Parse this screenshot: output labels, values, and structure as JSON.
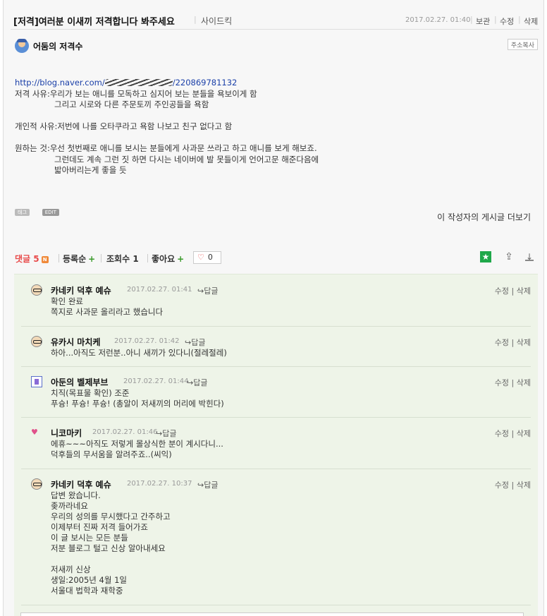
{
  "post": {
    "title": "[저격]여러분 이새끼 저격합니다 봐주세요",
    "category": "사이드킥",
    "date": "2017.02.27. 01:40",
    "actions": {
      "save": "보관",
      "edit": "수정",
      "delete": "삭제"
    },
    "author": "어둠의 저격수",
    "copy_address": "주소복사",
    "url_start": "http://blog.naver.com/",
    "url_end": "/220869781132",
    "lines": [
      "저격 사유:우리가 보는 애니를 모독하고 심지어 보는 분들을 욕보이게 함",
      "그리고 시로와 다른 주문토끼 주인공들을 욕함",
      "개인적 사유:저번에 나를 오타쿠라고 욕함 나보고 친구 없다고 함",
      "원하는 것:우선 첫번째로 애니를 보시는 분들에게 사과문 쓰라고 하고 애니를 보게 해보죠.",
      "그런데도 계속 그런 짓 하면 다시는 네이버에 발 못들이게 언어고문 해준다음에",
      "밟아버리는게 좋을 듯"
    ],
    "tag_label": "태그",
    "edit_label": "EDIT",
    "more_posts": "이 작성자의 게시글 더보기"
  },
  "stats": {
    "comments_label": "댓글",
    "comments_count": "5",
    "new_badge": "N",
    "sort_label": "등록순",
    "views_label": "조회수",
    "views_count": "1",
    "likes_label": "좋아요",
    "like_count": "0",
    "plus": "+"
  },
  "comment_ui": {
    "reply": "답글",
    "edit": "수정",
    "delete": "삭제"
  },
  "comments": [
    {
      "name": "카네키 덕후 예슈",
      "date": "2017.02.27. 01:41",
      "lines": [
        "확인 완료",
        "쪽지로 사과문 올리라고 했습니다"
      ]
    },
    {
      "name": "유카시 마치케",
      "date": "2017.02.27. 01:42",
      "lines": [
        "하아...아직도 저런분..아니 새끼가 있다니(절레절레)"
      ]
    },
    {
      "name": "아둔의 벨제부브",
      "date": "2017.02.27. 01:44",
      "lines": [
        "치직(목표물 확인) 조준",
        "푸슝! 푸슝! 푸슝! (총알이 저새끼의 머리에 박힌다)"
      ]
    },
    {
      "name": "니코마키",
      "date": "2017.02.27. 01:46",
      "lines": [
        "에휴~~~아직도 저렇게 몰상식한 분이 계시다니...",
        "덕후들의 무서움을 알려주죠..(씨익)"
      ]
    },
    {
      "name": "카네키 덕후 예슈",
      "date": "2017.02.27. 10:37",
      "lines": [
        "답변 왔습니다.",
        "좆까라네요",
        "우리의 성의를 무시했다고 간주하고",
        "이제부터 진짜 저격 들어가죠",
        "이 글 보시는 모든 분들",
        "저분 블로그 털고 신상 알아내세요",
        "",
        "저새끼 신상",
        "생일:2005년 4월 1일",
        "서울대 법학과 재학중"
      ]
    }
  ]
}
